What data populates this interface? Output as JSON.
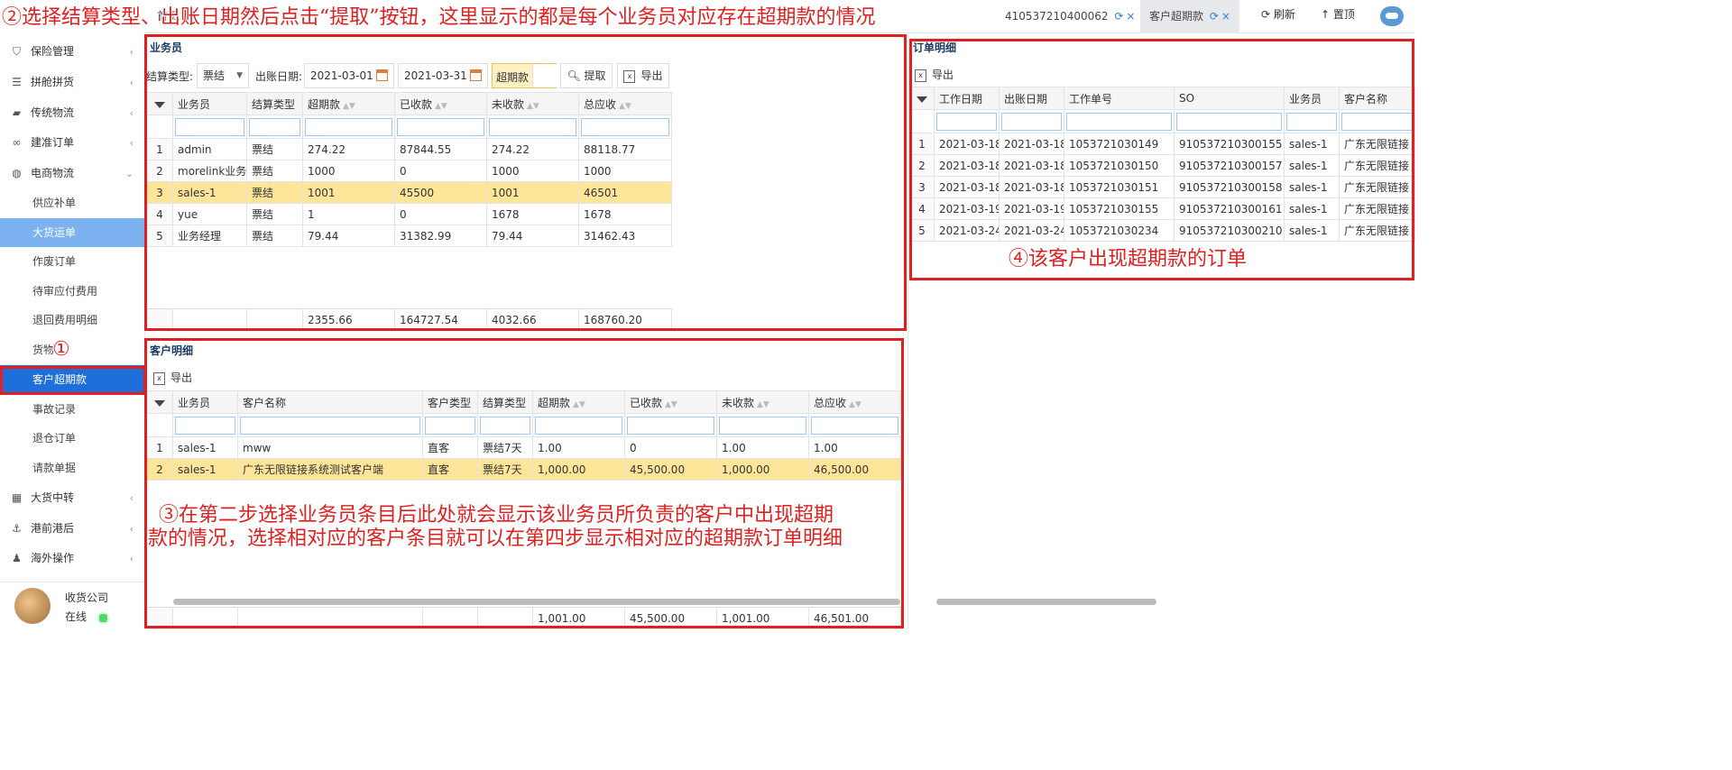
{
  "topbar": {
    "tabs": [
      {
        "label": "首页"
      },
      {
        "label": "410537210400062"
      },
      {
        "label": "客户超期款"
      }
    ],
    "refresh_label": "刷新",
    "top_label": "置顶"
  },
  "sidebar": {
    "items": [
      {
        "label": "保险管理",
        "icon": "shield-icon"
      },
      {
        "label": "拼舱拼货",
        "icon": "list-icon"
      },
      {
        "label": "传统物流",
        "icon": "truck-icon"
      },
      {
        "label": "建准订单",
        "icon": "link-icon"
      },
      {
        "label": "电商物流",
        "icon": "globe-icon"
      }
    ],
    "sub_items": [
      "供应补单",
      "大货运单",
      "作废订单",
      "待审应付费用",
      "退回费用明细",
      "货物",
      "客户超期款",
      "事故记录",
      "退仓订单",
      "请款单据"
    ],
    "lower_items": [
      {
        "label": "大货中转",
        "icon": "grid-icon"
      },
      {
        "label": "港前港后",
        "icon": "ship-icon"
      },
      {
        "label": "海外操作",
        "icon": "user-icon"
      }
    ],
    "user": {
      "name": "收货公司",
      "status": "在线"
    }
  },
  "salesman_panel": {
    "title": "业务员",
    "settle_type_label": "结算类型:",
    "settle_type_value": "票结",
    "bill_date_label": "出账日期:",
    "date_from": "2021-03-01",
    "date_to": "2021-03-31",
    "overdue_label": "超期款",
    "fetch_label": "提取",
    "export_label": "导出",
    "columns": [
      "业务员",
      "结算类型",
      "超期款",
      "已收款",
      "未收款",
      "总应收"
    ],
    "rows": [
      {
        "n": "1",
        "cells": [
          "admin",
          "票结",
          "274.22",
          "87844.55",
          "274.22",
          "88118.77"
        ]
      },
      {
        "n": "2",
        "cells": [
          "morelink业务员",
          "票结",
          "1000",
          "0",
          "1000",
          "1000"
        ]
      },
      {
        "n": "3",
        "cells": [
          "sales-1",
          "票结",
          "1001",
          "45500",
          "1001",
          "46501"
        ]
      },
      {
        "n": "4",
        "cells": [
          "yue",
          "票结",
          "1",
          "0",
          "1678",
          "1678"
        ]
      },
      {
        "n": "5",
        "cells": [
          "业务经理",
          "票结",
          "79.44",
          "31382.99",
          "79.44",
          "31462.43"
        ]
      }
    ],
    "totals": [
      "",
      "",
      "2355.66",
      "164727.54",
      "4032.66",
      "168760.20"
    ]
  },
  "customer_panel": {
    "title": "客户明细",
    "export_label": "导出",
    "columns": [
      "业务员",
      "客户名称",
      "客户类型",
      "结算类型",
      "超期款",
      "已收款",
      "未收款",
      "总应收"
    ],
    "rows": [
      {
        "n": "1",
        "cells": [
          "sales-1",
          "mww",
          "直客",
          "票结7天",
          "1.00",
          "0",
          "1.00",
          "1.00"
        ]
      },
      {
        "n": "2",
        "cells": [
          "sales-1",
          "广东无限链接系统测试客户端",
          "直客",
          "票结7天",
          "1,000.00",
          "45,500.00",
          "1,000.00",
          "46,500.00"
        ]
      }
    ],
    "totals": [
      "",
      "",
      "",
      "",
      "1,001.00",
      "45,500.00",
      "1,001.00",
      "46,501.00"
    ]
  },
  "order_panel": {
    "title": "订单明细",
    "export_label": "导出",
    "columns": [
      "工作日期",
      "出账日期",
      "工作单号",
      "SO",
      "业务员",
      "客户名称"
    ],
    "rows": [
      {
        "n": "1",
        "cells": [
          "2021-03-18",
          "2021-03-18",
          "1053721030149",
          "910537210300155",
          "sales-1",
          "广东无限链接"
        ]
      },
      {
        "n": "2",
        "cells": [
          "2021-03-18",
          "2021-03-18",
          "1053721030150",
          "910537210300157",
          "sales-1",
          "广东无限链接"
        ]
      },
      {
        "n": "3",
        "cells": [
          "2021-03-18",
          "2021-03-18",
          "1053721030151",
          "910537210300158",
          "sales-1",
          "广东无限链接"
        ]
      },
      {
        "n": "4",
        "cells": [
          "2021-03-19",
          "2021-03-19",
          "1053721030155",
          "910537210300161",
          "sales-1",
          "广东无限链接"
        ]
      },
      {
        "n": "5",
        "cells": [
          "2021-03-24",
          "2021-03-24",
          "1053721030234",
          "910537210300210",
          "sales-1",
          "广东无限链接"
        ]
      }
    ]
  },
  "annotations": {
    "step1": "①",
    "step2": "②选择结算类型、出账日期然后点击“提取”按钮，这里显示的都是每个业务员对应存在超期款的情况",
    "step3_line1": "③在第二步选择业务员条目后此处就会显示该业务员所负责的客户中出现超期",
    "step3_line2": "款的情况，选择相对应的客户条目就可以在第四步显示相对应的超期款订单明细",
    "step4": "④该客户出现超期款的订单"
  },
  "colors": {
    "accent": "#1e6fd9",
    "selected_row": "#fde59a",
    "annotation": "#e02020"
  }
}
